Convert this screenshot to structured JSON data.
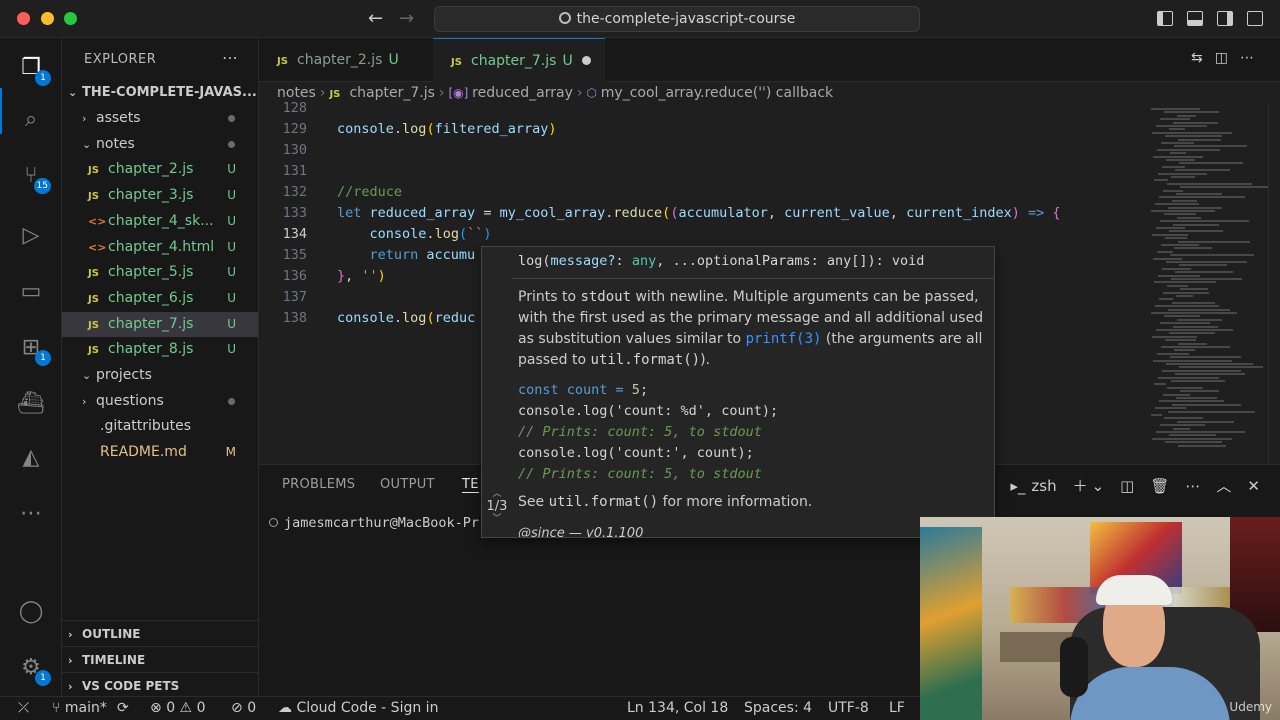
{
  "window": {
    "title": "the-complete-javascript-course"
  },
  "activity": {
    "explorer_badge": "1",
    "source_control_badge": "15",
    "extensions_badge": "1",
    "settings_badge": "1"
  },
  "sidebar": {
    "title": "EXPLORER",
    "root": "THE-COMPLETE-JAVAS...",
    "items": [
      {
        "label": "assets",
        "kind": "folder",
        "chevron": "›",
        "status": "dot"
      },
      {
        "label": "notes",
        "kind": "folder-open",
        "chevron": "⌄",
        "status": "dot"
      },
      {
        "label": "chapter_2.js",
        "kind": "js",
        "status": "U"
      },
      {
        "label": "chapter_3.js",
        "kind": "js",
        "status": "U"
      },
      {
        "label": "chapter_4_sk...",
        "kind": "html",
        "status": "U"
      },
      {
        "label": "chapter_4.html",
        "kind": "html",
        "status": "U"
      },
      {
        "label": "chapter_5.js",
        "kind": "js",
        "status": "U"
      },
      {
        "label": "chapter_6.js",
        "kind": "js",
        "status": "U"
      },
      {
        "label": "chapter_7.js",
        "kind": "js",
        "status": "U",
        "selected": true
      },
      {
        "label": "chapter_8.js",
        "kind": "js",
        "status": "U"
      },
      {
        "label": "projects",
        "kind": "folder",
        "chevron": "⌄",
        "status": ""
      },
      {
        "label": "questions",
        "kind": "folder",
        "chevron": "›",
        "status": "dot"
      },
      {
        "label": ".gitattributes",
        "kind": "file",
        "status": ""
      },
      {
        "label": "README.md",
        "kind": "md",
        "status": "M"
      }
    ],
    "sections": [
      "OUTLINE",
      "TIMELINE",
      "VS CODE PETS"
    ]
  },
  "tabs": [
    {
      "label": "chapter_2.js",
      "status": "U"
    },
    {
      "label": "chapter_7.js",
      "status": "U"
    }
  ],
  "breadcrumbs": {
    "folder": "notes",
    "file": "chapter_7.js",
    "symbol1": "reduced_array",
    "symbol2": "my_cool_array.reduce('') callback"
  },
  "editor": {
    "lines": [
      {
        "n": "128",
        "parts": []
      },
      {
        "n": "129",
        "parts": [
          [
            "var",
            "console"
          ],
          [
            "pl",
            "."
          ],
          [
            "fn",
            "log"
          ],
          [
            "br1",
            "("
          ],
          [
            "var",
            "filtered_array"
          ],
          [
            "br1",
            ")"
          ]
        ]
      },
      {
        "n": "130",
        "parts": []
      },
      {
        "n": "131",
        "parts": []
      },
      {
        "n": "132",
        "parts": [
          [
            "cm",
            "//reduce"
          ]
        ]
      },
      {
        "n": "133",
        "parts": [
          [
            "kw",
            "let "
          ],
          [
            "var",
            "reduced_array"
          ],
          [
            "pl",
            " = "
          ],
          [
            "var",
            "my_cool_array"
          ],
          [
            "pl",
            "."
          ],
          [
            "fn",
            "reduce"
          ],
          [
            "br1",
            "("
          ],
          [
            "br2",
            "("
          ],
          [
            "var",
            "accumulator"
          ],
          [
            "pl",
            ", "
          ],
          [
            "var",
            "current_value"
          ],
          [
            "pl",
            ", "
          ],
          [
            "var",
            "current_index"
          ],
          [
            "br2",
            ")"
          ],
          [
            "kw",
            " => "
          ],
          [
            "br2",
            "{"
          ]
        ]
      },
      {
        "n": "134",
        "parts": [
          [
            "pl",
            "    "
          ],
          [
            "var",
            "console"
          ],
          [
            "pl",
            "."
          ],
          [
            "fn",
            "log"
          ],
          [
            "br3",
            "("
          ],
          [
            "str",
            "``"
          ],
          [
            "br3",
            ")"
          ]
        ],
        "current": true
      },
      {
        "n": "135",
        "parts": [
          [
            "pl",
            "    "
          ],
          [
            "kw",
            "return "
          ],
          [
            "var",
            "accumu"
          ]
        ]
      },
      {
        "n": "136",
        "parts": [
          [
            "br2",
            "}"
          ],
          [
            "pl",
            ", "
          ],
          [
            "str",
            "''"
          ],
          [
            "br1",
            ")"
          ]
        ]
      },
      {
        "n": "137",
        "parts": []
      },
      {
        "n": "138",
        "parts": [
          [
            "var",
            "console"
          ],
          [
            "pl",
            "."
          ],
          [
            "fn",
            "log"
          ],
          [
            "br1",
            "("
          ],
          [
            "var",
            "reduc"
          ]
        ]
      }
    ]
  },
  "hover": {
    "sig_fn": "log(",
    "sig_param1": "message?",
    "sig_colon1": ": ",
    "sig_type1": "any",
    "sig_rest": ", ...optionalParams: any[]): void",
    "desc_1": "Prints to ",
    "desc_stdout": "stdout",
    "desc_2": " with newline. Multiple arguments can be passed, with the first used as the primary message and all additional used as substitution values similar to ",
    "desc_printf": "printf(3)",
    "desc_3": " (the arguments are all passed to ",
    "desc_utilformat": "util.format()",
    "desc_4": ").",
    "code_1_a": "const count = ",
    "code_1_num": "5",
    "code_1_b": ";",
    "code_2": "console.log('count: %d', count);",
    "code_3": "// Prints: count: 5, to stdout",
    "code_4": "console.log('count:', count);",
    "code_5": "// Prints: count: 5, to stdout",
    "more_1": "See ",
    "more_code": "util.format()",
    "more_2": " for more information.",
    "since": "@since — v0.1.100",
    "overload": "1/3"
  },
  "panel": {
    "tabs": [
      "PROBLEMS",
      "OUTPUT",
      "TE"
    ],
    "shell": "zsh",
    "terminal_line": "jamesmcarthur@MacBook-Pr"
  },
  "webcam": {
    "watermark": "Udemy"
  },
  "status": {
    "branch": "main*",
    "errors": "0",
    "warnings": "0",
    "ports": "0",
    "cloud": "Cloud Code - Sign in",
    "position": "Ln 134, Col 18",
    "spaces": "Spaces: 4",
    "encoding": "UTF-8",
    "eol": "LF"
  },
  "colors": {
    "accent": "#0078d4",
    "untracked": "#73c991",
    "modified": "#e2c08d"
  }
}
